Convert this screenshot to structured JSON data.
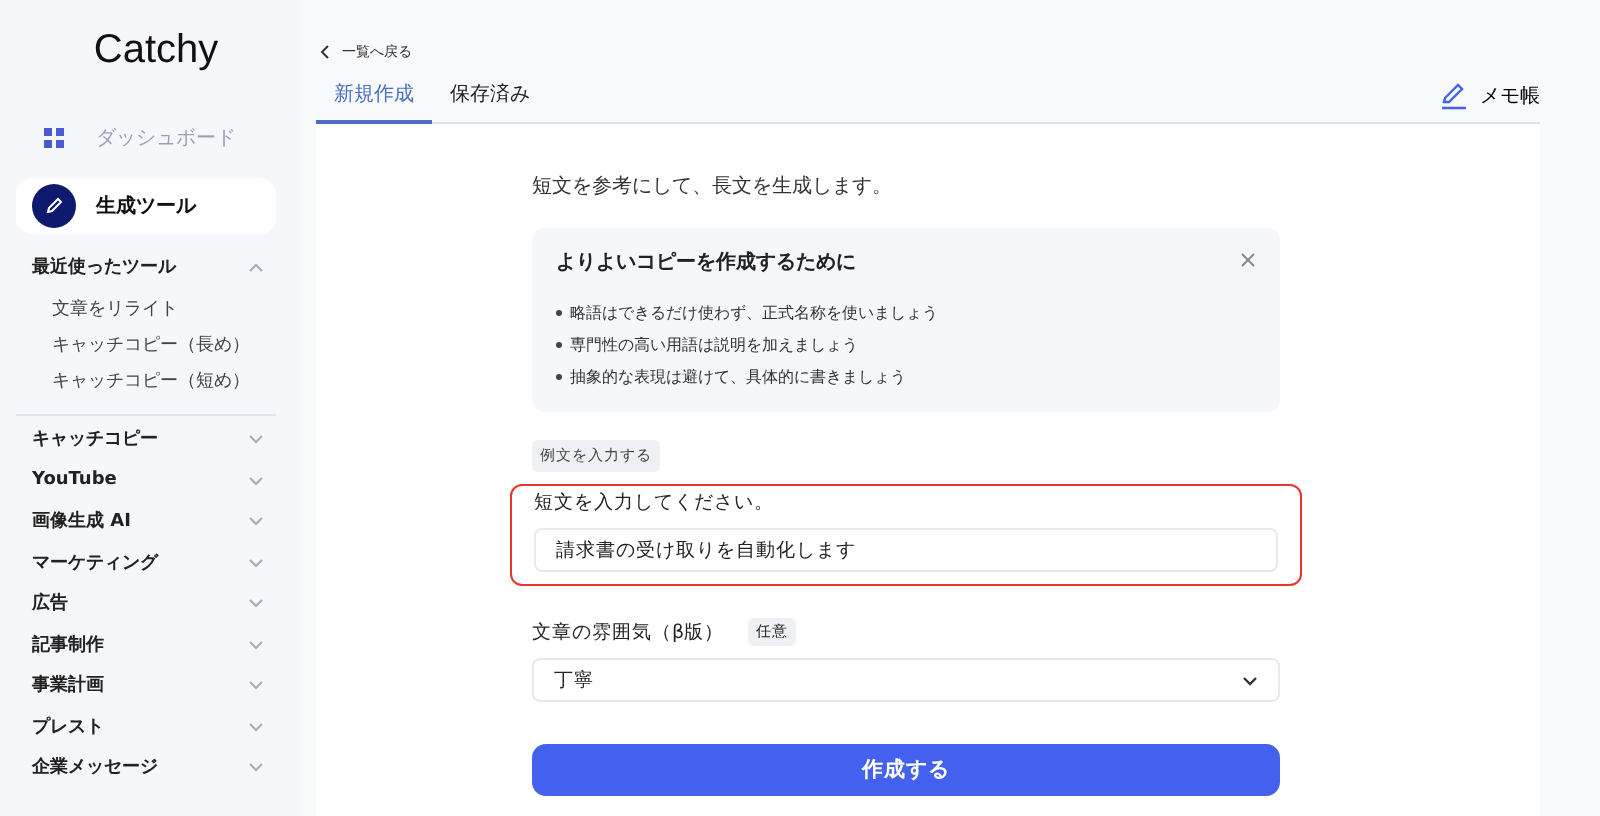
{
  "sidebar": {
    "logo": "Catchy",
    "nav": [
      {
        "label": "ダッシュボード",
        "kind": "link",
        "selected": false
      },
      {
        "label": "生成ツール",
        "kind": "link",
        "selected": true
      }
    ],
    "recent": {
      "title": "最近使ったツール",
      "expanded": true,
      "items": [
        "文章をリライト",
        "キャッチコピー（長め）",
        "キャッチコピー（短め）"
      ]
    },
    "categories": [
      {
        "label": "キャッチコピー",
        "expanded": false
      },
      {
        "label": "YouTube",
        "expanded": false
      },
      {
        "label": "画像生成 AI",
        "expanded": false
      },
      {
        "label": "マーケティング",
        "expanded": false
      },
      {
        "label": "広告",
        "expanded": false
      },
      {
        "label": "記事制作",
        "expanded": false
      },
      {
        "label": "事業計画",
        "expanded": false
      },
      {
        "label": "プレスト",
        "expanded": false
      },
      {
        "label": "企業メッセージ",
        "expanded": false
      }
    ]
  },
  "back_link": "一覧へ戻る",
  "tabs": [
    {
      "label": "新規作成",
      "selected": true
    },
    {
      "label": "保存済み",
      "selected": false
    }
  ],
  "memo_button": "メモ帳",
  "description": "短文を参考にして、長文を生成します。",
  "tip_card": {
    "title": "よりよいコピーを作成するために",
    "items": [
      "略語はできるだけ使わず、正式名称を使いましょう",
      "専門性の高い用語は説明を加えましょう",
      "抽象的な表現は避けて、具体的に書きましょう"
    ]
  },
  "example_button": "例文を入力する",
  "short_text": {
    "label": "短文を入力してください。",
    "value": "請求書の受け取りを自動化します",
    "highlighted": true
  },
  "tone": {
    "label": "文章の雰囲気（β版）",
    "badge": "任意",
    "value": "丁寧"
  },
  "submit_button": "作成する"
}
